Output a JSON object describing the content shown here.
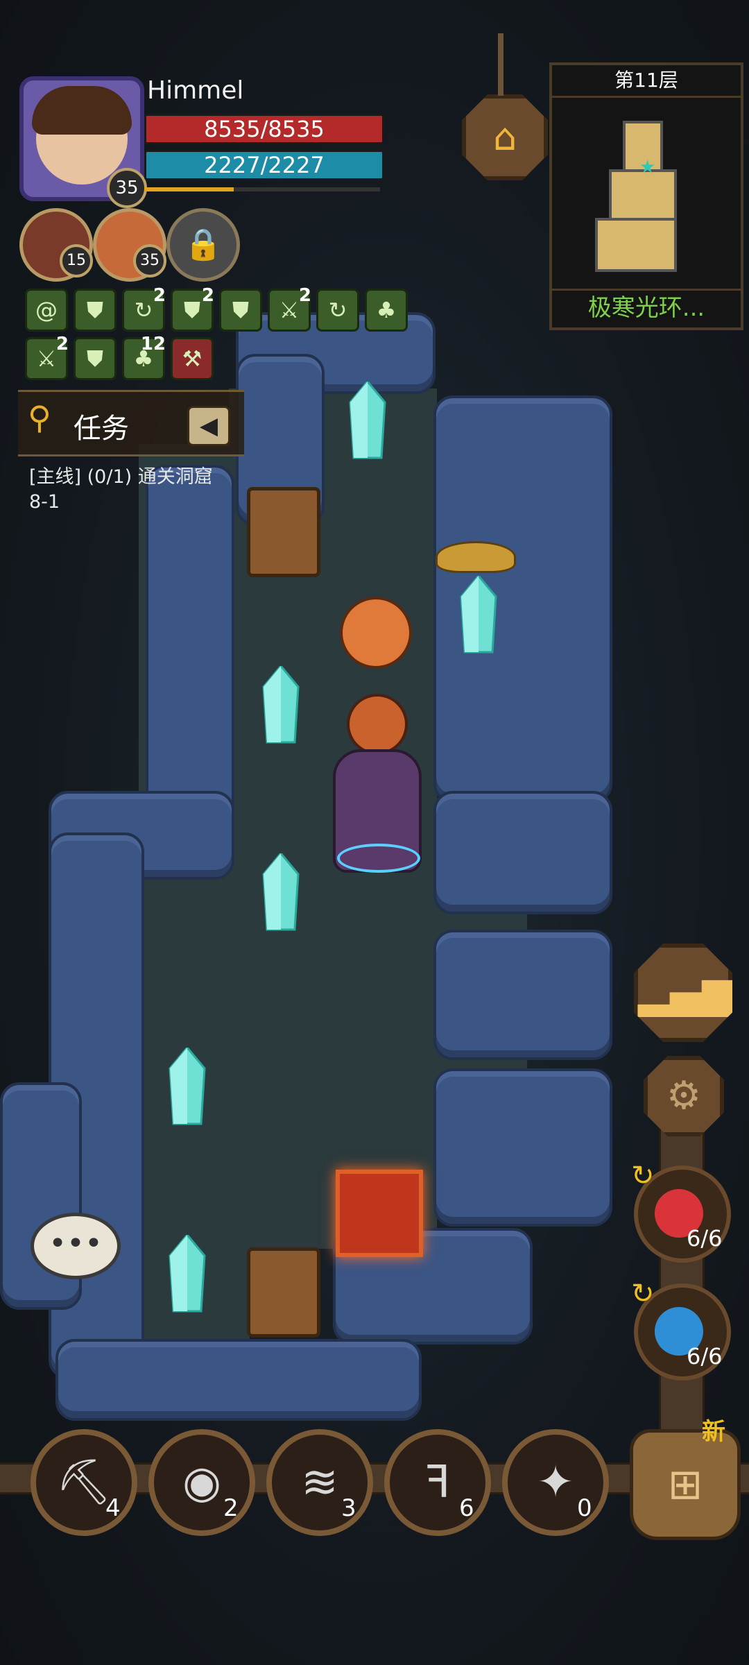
{
  "player": {
    "name": "Himmel",
    "level": "35",
    "hp": "8535/8535",
    "mp": "2227/2227",
    "xp_fraction": 0.38
  },
  "companions": [
    {
      "level": "15"
    },
    {
      "level": "35"
    },
    {
      "locked_icon": "lock-icon"
    }
  ],
  "buffs_row1": [
    {
      "icon": "swirl-icon",
      "count": ""
    },
    {
      "icon": "shield-icon",
      "count": ""
    },
    {
      "icon": "spin-icon",
      "count": "2"
    },
    {
      "icon": "shield-icon",
      "count": "2"
    },
    {
      "icon": "shield-icon",
      "count": ""
    },
    {
      "icon": "sword-icon",
      "count": "2"
    },
    {
      "icon": "spin-icon",
      "count": ""
    },
    {
      "icon": "clover-icon",
      "count": ""
    }
  ],
  "buffs_row2": [
    {
      "icon": "sword-icon",
      "count": "2"
    },
    {
      "icon": "shield-icon",
      "count": ""
    },
    {
      "icon": "clover-icon",
      "count": "12"
    },
    {
      "icon": "axe-icon",
      "count": ""
    }
  ],
  "quest": {
    "title": "任务",
    "text": "[主线] (0/1) 通关洞窟\n8-1"
  },
  "minimap": {
    "floor_label": "第11层",
    "aura_label": "极寒光环..."
  },
  "potions": [
    {
      "type": "red",
      "count": "6/6"
    },
    {
      "type": "blue",
      "count": "6/6"
    }
  ],
  "tools": [
    {
      "icon": "pickaxe-icon",
      "count": "4"
    },
    {
      "icon": "dragon-eye-icon",
      "count": "2"
    },
    {
      "icon": "scroll-icon",
      "count": "3"
    },
    {
      "icon": "claw-icon",
      "count": "6"
    },
    {
      "icon": "drill-icon",
      "count": "0"
    }
  ],
  "bag": {
    "badge": "新"
  },
  "colors": {
    "hp": "#b42a2a",
    "mp": "#1d8ca6",
    "xp": "#e2a31f",
    "aura_text": "#7ed14a",
    "rock": "#3b5584",
    "crystal": "#6ee0d4"
  }
}
